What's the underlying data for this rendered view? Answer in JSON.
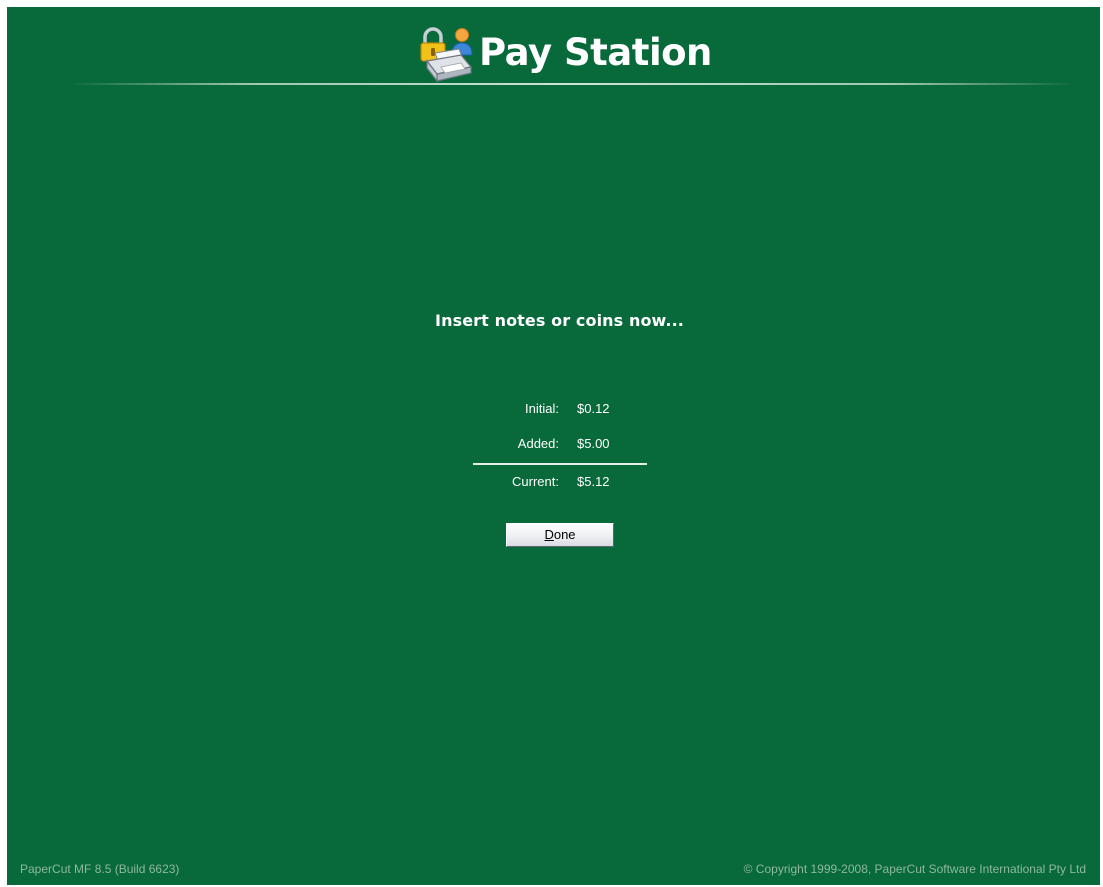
{
  "header": {
    "title": "Pay Station"
  },
  "main": {
    "prompt": "Insert notes or coins now...",
    "balance": {
      "initial_label": "Initial:",
      "initial_value": "$0.12",
      "added_label": "Added:",
      "added_value": "$5.00",
      "current_label": "Current:",
      "current_value": "$5.12"
    },
    "done_button": {
      "mnemonic": "D",
      "rest": "one"
    }
  },
  "footer": {
    "version": "PaperCut MF 8.5 (Build 6623)",
    "copyright": "© Copyright 1999-2008, PaperCut Software International Pty Ltd"
  },
  "colors": {
    "background": "#08693a",
    "text": "#ffffff",
    "footer_text": "#8fb89d"
  },
  "icons": {
    "logo": "printer-lock-user-icon"
  }
}
